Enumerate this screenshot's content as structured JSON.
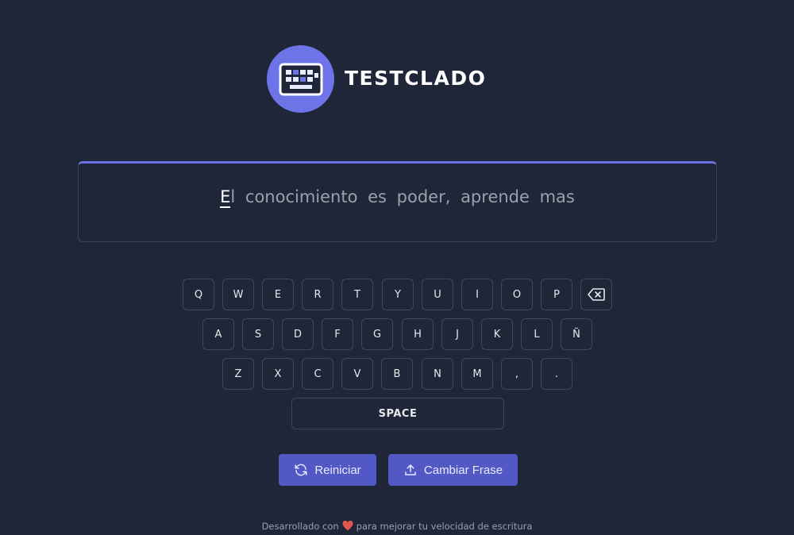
{
  "header": {
    "brand": "TESTCLADO",
    "logo_icon": "keyboard-icon",
    "accent_color": "#6d74e8"
  },
  "phrase": {
    "typed": "E",
    "current": "l",
    "remaining": " conocimiento es poder, aprende mas"
  },
  "keyboard": {
    "row1": [
      "Q",
      "W",
      "E",
      "R",
      "T",
      "Y",
      "U",
      "I",
      "O",
      "P"
    ],
    "backspace_icon": "backspace-icon",
    "row2": [
      "A",
      "S",
      "D",
      "F",
      "G",
      "H",
      "J",
      "K",
      "L",
      "Ñ"
    ],
    "row3": [
      "Z",
      "X",
      "C",
      "V",
      "B",
      "N",
      "M",
      ",",
      "."
    ],
    "space_label": "SPACE"
  },
  "buttons": {
    "restart_label": "Reiniciar",
    "restart_icon": "refresh-icon",
    "change_label": "Cambiar Frase",
    "change_icon": "upload-icon",
    "color": "#5259c4"
  },
  "footer": {
    "before": "Desarrollado con",
    "heart_icon": "heart-icon",
    "after": "para mejorar tu velocidad de escritura"
  }
}
